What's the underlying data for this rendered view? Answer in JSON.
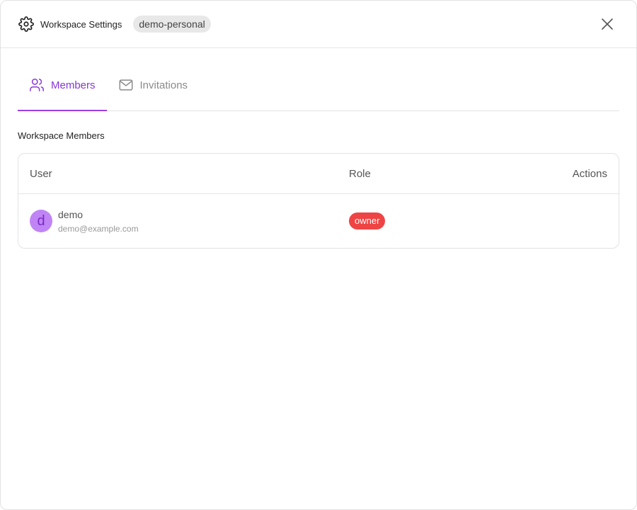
{
  "header": {
    "title": "Workspace Settings",
    "workspace_badge": "demo-personal"
  },
  "tabs": [
    {
      "label": "Members",
      "icon": "users-icon",
      "active": true
    },
    {
      "label": "Invitations",
      "icon": "mail-icon",
      "active": false
    }
  ],
  "section": {
    "title": "Workspace Members"
  },
  "table": {
    "columns": [
      "User",
      "Role",
      "Actions"
    ],
    "rows": [
      {
        "avatar_letter": "d",
        "name": "demo",
        "email": "demo@example.com",
        "role": "owner"
      }
    ]
  },
  "colors": {
    "accent": "#8a35d6",
    "owner_badge": "#ef4444",
    "avatar_bg": "#c084f5"
  }
}
